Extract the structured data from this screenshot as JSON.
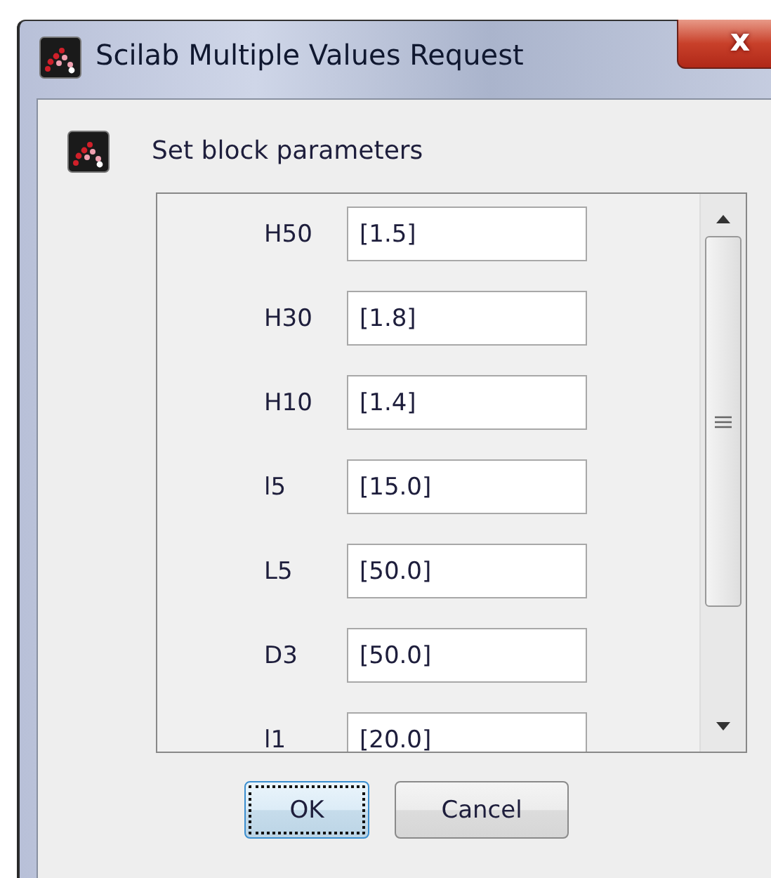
{
  "window": {
    "title": "Scilab Multiple Values Request",
    "close_label": "x"
  },
  "header": {
    "text": "Set block parameters"
  },
  "parameters": [
    {
      "label": "H50",
      "value": "[1.5]"
    },
    {
      "label": "H30",
      "value": "[1.8]"
    },
    {
      "label": "H10",
      "value": "[1.4]"
    },
    {
      "label": "l5",
      "value": "[15.0]"
    },
    {
      "label": "L5",
      "value": "[50.0]"
    },
    {
      "label": "D3",
      "value": "[50.0]"
    },
    {
      "label": "l1",
      "value": "[20.0]"
    }
  ],
  "buttons": [
    {
      "label": "OK",
      "focused": true
    },
    {
      "label": "Cancel",
      "focused": false
    }
  ]
}
